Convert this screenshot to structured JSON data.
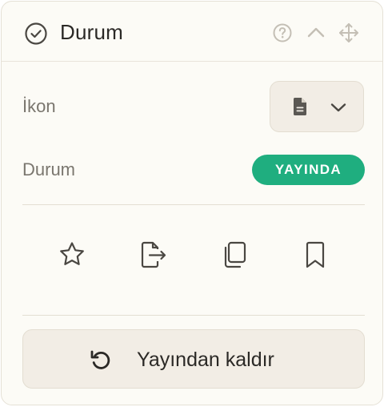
{
  "header": {
    "title": "Durum",
    "icons": [
      "check-circle-icon",
      "help-icon",
      "chevron-up-icon",
      "move-icon"
    ]
  },
  "icon_row": {
    "label": "İkon",
    "selected_icon": "document-icon",
    "dropdown_icon": "chevron-down-icon"
  },
  "status_row": {
    "label": "Durum",
    "badge": "YAYINDA",
    "badge_color": "#1fae7f"
  },
  "actions": [
    "star-icon",
    "export-icon",
    "copy-icon",
    "bookmark-icon"
  ],
  "unpublish": {
    "label": "Yayından kaldır",
    "icon": "undo-icon"
  },
  "colors": {
    "panel_bg": "#fcfbf6",
    "button_bg": "#f2ede5",
    "text": "#2b2926",
    "muted_text": "#7a766e",
    "icon_muted": "#c4bfb5"
  }
}
